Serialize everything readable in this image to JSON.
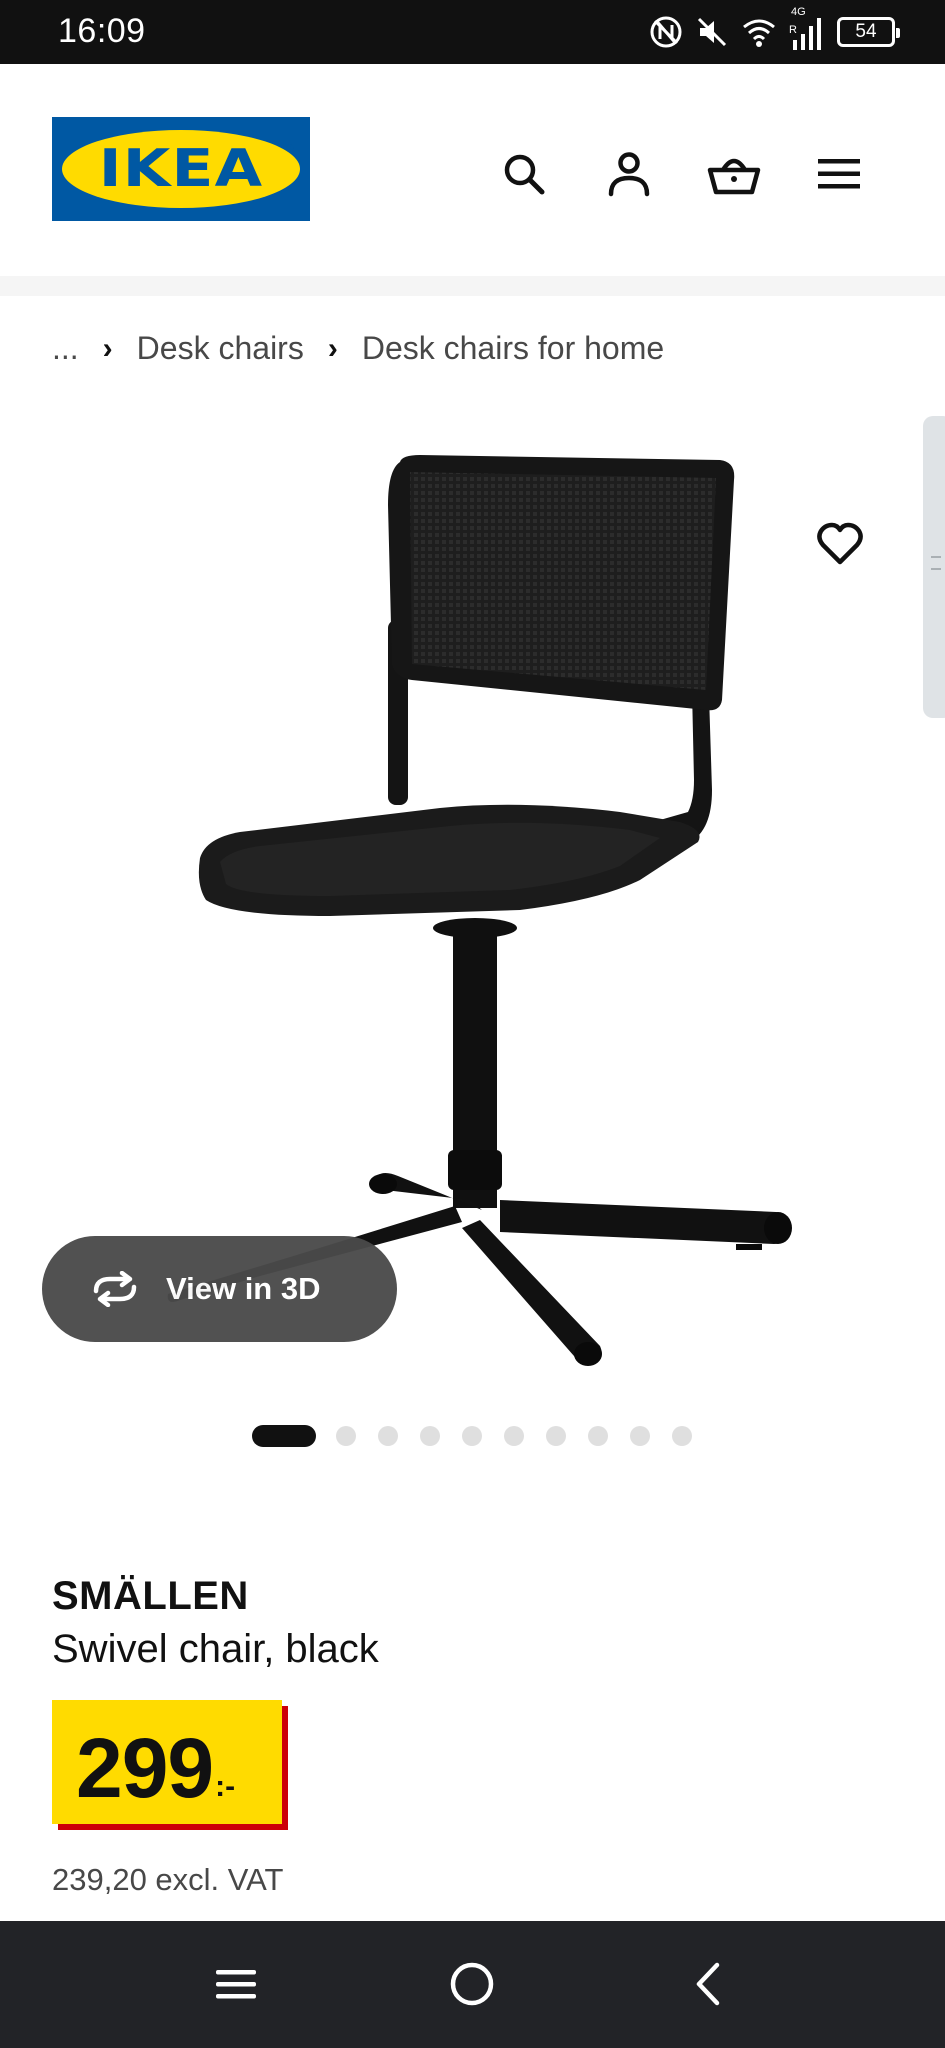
{
  "status_bar": {
    "time": "16:09",
    "network_label": "4G",
    "roaming_label": "R",
    "battery": "54"
  },
  "header": {
    "logo_text": "IKEA",
    "logo_registered": "®",
    "icons": [
      "search-icon",
      "account-icon",
      "shopping-bag-icon",
      "menu-icon"
    ]
  },
  "breadcrumb": {
    "ellipsis": "...",
    "separator": "›",
    "items": [
      "Desk chairs",
      "Desk chairs for home"
    ]
  },
  "media": {
    "view_3d_label": "View in 3D",
    "image_count": 11,
    "active_image_index": 0
  },
  "product": {
    "name": "SMÄLLEN",
    "description": "Swivel chair, black",
    "price": "299",
    "price_suffix": ":-",
    "price_excl_vat": "239,20 excl. VAT"
  },
  "colors": {
    "ikea_blue": "#0058a3",
    "ikea_yellow": "#ffdb00",
    "price_shadow_red": "#cc0008",
    "status_bar_bg": "#111111",
    "nav_bar_bg": "#222327"
  },
  "nav_bar": {
    "icons": [
      "recents-icon",
      "home-icon",
      "back-icon"
    ]
  }
}
